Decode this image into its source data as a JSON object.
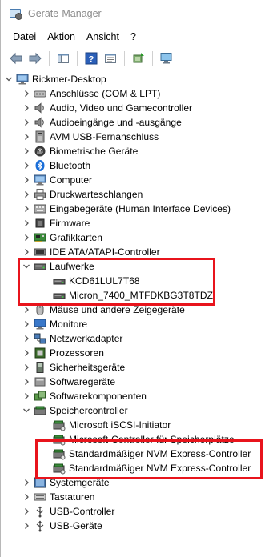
{
  "window": {
    "title": "Geräte-Manager"
  },
  "menu": [
    "Datei",
    "Aktion",
    "Ansicht",
    "?"
  ],
  "tree": {
    "root": "Rickmer-Desktop",
    "categories": [
      {
        "label": "Anschlüsse (COM & LPT)",
        "icon": "port-icon",
        "expanded": false
      },
      {
        "label": "Audio, Video und Gamecontroller",
        "icon": "speaker-icon",
        "expanded": false
      },
      {
        "label": "Audioeingänge und -ausgänge",
        "icon": "speaker-icon",
        "expanded": false
      },
      {
        "label": "AVM USB-Fernanschluss",
        "icon": "usb-remote-icon",
        "expanded": false
      },
      {
        "label": "Biometrische Geräte",
        "icon": "fingerprint-icon",
        "expanded": false
      },
      {
        "label": "Bluetooth",
        "icon": "bluetooth-icon",
        "expanded": false
      },
      {
        "label": "Computer",
        "icon": "computer-icon",
        "expanded": false
      },
      {
        "label": "Druckwarteschlangen",
        "icon": "printer-icon",
        "expanded": false
      },
      {
        "label": "Eingabegeräte (Human Interface Devices)",
        "icon": "hid-icon",
        "expanded": false
      },
      {
        "label": "Firmware",
        "icon": "chip-icon",
        "expanded": false
      },
      {
        "label": "Grafikkarten",
        "icon": "display-adapter-icon",
        "expanded": false
      },
      {
        "label": "IDE ATA/ATAPI-Controller",
        "icon": "ide-controller-icon",
        "expanded": false
      },
      {
        "label": "Laufwerke",
        "icon": "disk-drive-icon",
        "expanded": true,
        "children": [
          "KCD61LUL7T68",
          "Micron_7400_MTFDKBG3T8TDZ"
        ]
      },
      {
        "label": "Mäuse und andere Zeigegeräte",
        "icon": "mouse-icon",
        "expanded": false
      },
      {
        "label": "Monitore",
        "icon": "monitor-icon",
        "expanded": false
      },
      {
        "label": "Netzwerkadapter",
        "icon": "network-adapter-icon",
        "expanded": false
      },
      {
        "label": "Prozessoren",
        "icon": "processor-icon",
        "expanded": false
      },
      {
        "label": "Sicherheitsgeräte",
        "icon": "security-device-icon",
        "expanded": false
      },
      {
        "label": "Softwaregeräte",
        "icon": "software-device-icon",
        "expanded": false
      },
      {
        "label": "Softwarekomponenten",
        "icon": "software-component-icon",
        "expanded": false
      },
      {
        "label": "Speichercontroller",
        "icon": "storage-controller-icon",
        "expanded": true,
        "children": [
          "Microsoft iSCSI-Initiator",
          "Microsoft-Controller für Speicherplätze",
          "Standardmäßiger NVM Express-Controller",
          "Standardmäßiger NVM Express-Controller"
        ]
      },
      {
        "label": "Systemgeräte",
        "icon": "system-device-icon",
        "expanded": false
      },
      {
        "label": "Tastaturen",
        "icon": "keyboard-icon",
        "expanded": false
      },
      {
        "label": "USB-Controller",
        "icon": "usb-icon",
        "expanded": false
      },
      {
        "label": "USB-Geräte",
        "icon": "usb-icon",
        "expanded": false
      }
    ]
  },
  "colors": {
    "highlight": "#e8141c",
    "accent": "#1a73e8"
  }
}
